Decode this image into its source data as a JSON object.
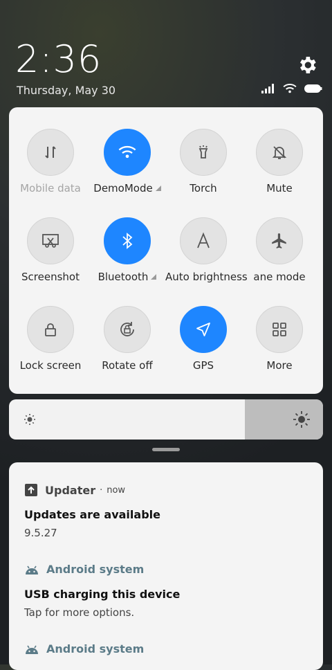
{
  "status": {
    "time": "2:36",
    "date": "Thursday, May 30"
  },
  "colors": {
    "accent": "#1e86ff",
    "tile_bg": "#e3e3e3",
    "panel_bg": "#f4f4f4"
  },
  "tiles": [
    {
      "label": "Mobile data",
      "icon": "mobile-data-icon",
      "active": false,
      "dim": true
    },
    {
      "label": "DemoMode",
      "icon": "wifi-icon",
      "active": true,
      "arrow": true
    },
    {
      "label": "Torch",
      "icon": "torch-icon",
      "active": false
    },
    {
      "label": "Mute",
      "icon": "mute-bell-icon",
      "active": false
    },
    {
      "label": "Screenshot",
      "icon": "screenshot-icon",
      "active": false
    },
    {
      "label": "Bluetooth",
      "icon": "bluetooth-icon",
      "active": true,
      "arrow": true
    },
    {
      "label": "Auto brightness",
      "icon": "auto-brightness-icon",
      "active": false
    },
    {
      "label": "ane mode",
      "icon": "airplane-icon",
      "active": false
    },
    {
      "label": "Lock screen",
      "icon": "lock-icon",
      "active": false
    },
    {
      "label": "Rotate off",
      "icon": "rotate-lock-icon",
      "active": false
    },
    {
      "label": "GPS",
      "icon": "location-arrow-icon",
      "active": true
    },
    {
      "label": "More",
      "icon": "grid-icon",
      "active": false
    }
  ],
  "brightness": {
    "level_percent": 75
  },
  "notifications": [
    {
      "app": "Updater",
      "time": "now",
      "title": "Updates are available",
      "body": "9.5.27"
    },
    {
      "app": "Android system",
      "title": "USB charging this device",
      "body": "Tap for more options."
    },
    {
      "app": "Android system"
    }
  ]
}
